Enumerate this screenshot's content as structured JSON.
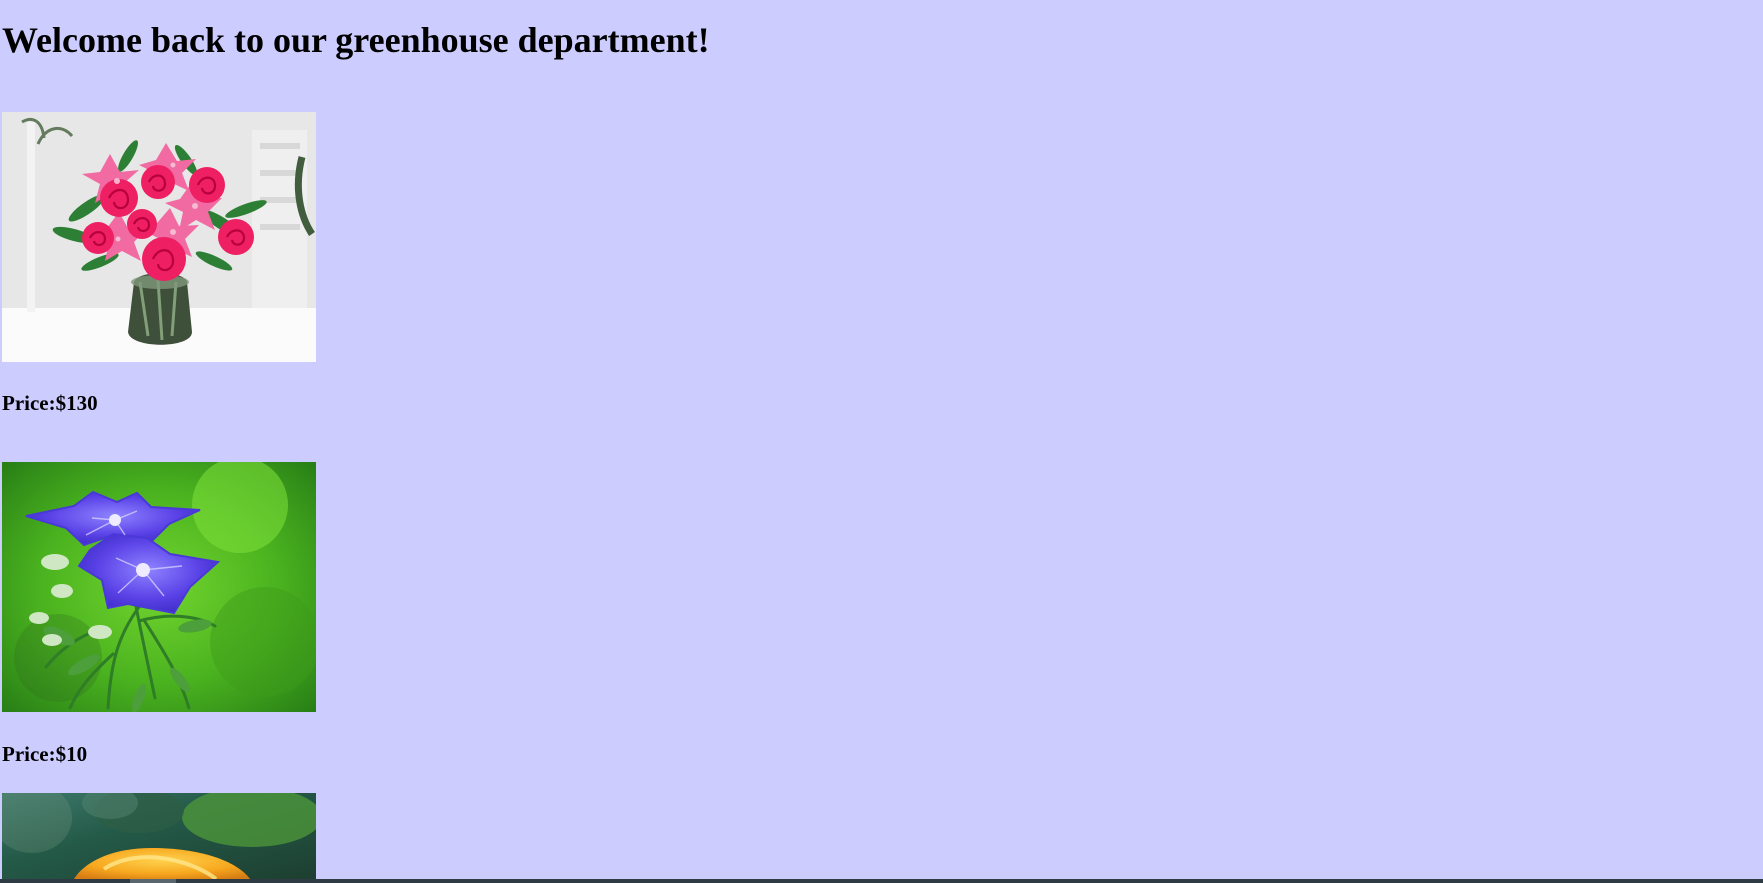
{
  "page": {
    "heading": "Welcome back to our greenhouse department!",
    "background_color": "#ccccff"
  },
  "products": [
    {
      "image_icon": "flower-bouquet-icon",
      "price_text": "Price:$130"
    },
    {
      "image_icon": "purple-flower-icon",
      "price_text": "Price:$10"
    },
    {
      "image_icon": "yellow-flower-icon",
      "price_text": ""
    }
  ]
}
